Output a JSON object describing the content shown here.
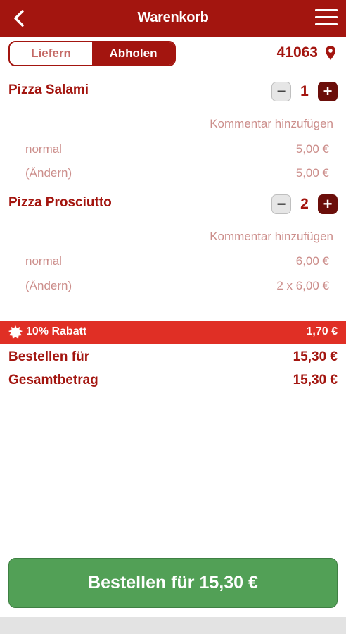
{
  "header": {
    "title": "Warenkorb",
    "back_icon": "chevron-left-icon",
    "menu_icon": "hamburger-menu-icon",
    "color": "#a3150f"
  },
  "mode": {
    "options": [
      "Liefern",
      "Abholen"
    ],
    "selected": "Abholen"
  },
  "location": {
    "zip": "41063",
    "icon": "map-pin-icon"
  },
  "cart": {
    "items": [
      {
        "name": "Pizza Salami",
        "quantity": "1",
        "comment_label": "Kommentar hinzufügen",
        "details": [
          {
            "label": "normal",
            "price": "5,00 €"
          },
          {
            "label": "(Ändern)",
            "price": "5,00 €"
          }
        ]
      },
      {
        "name": "Pizza Prosciutto",
        "quantity": "2",
        "comment_label": "Kommentar hinzufügen",
        "details": [
          {
            "label": "normal",
            "price": "6,00 €"
          },
          {
            "label": "(Ändern)",
            "price": "2 x 6,00 €"
          }
        ]
      }
    ]
  },
  "discount": {
    "label": "10% Rabatt",
    "value": "1,70 €",
    "icon": "burst-badge-icon",
    "color": "#e02f25"
  },
  "totals": {
    "order_for_label": "Bestellen für",
    "order_for_value": "15,30 €",
    "total_label": "Gesamtbetrag",
    "total_value": "15,30 €"
  },
  "order_button": {
    "label": "Bestellen für 15,30 €",
    "color": "#52a056"
  }
}
